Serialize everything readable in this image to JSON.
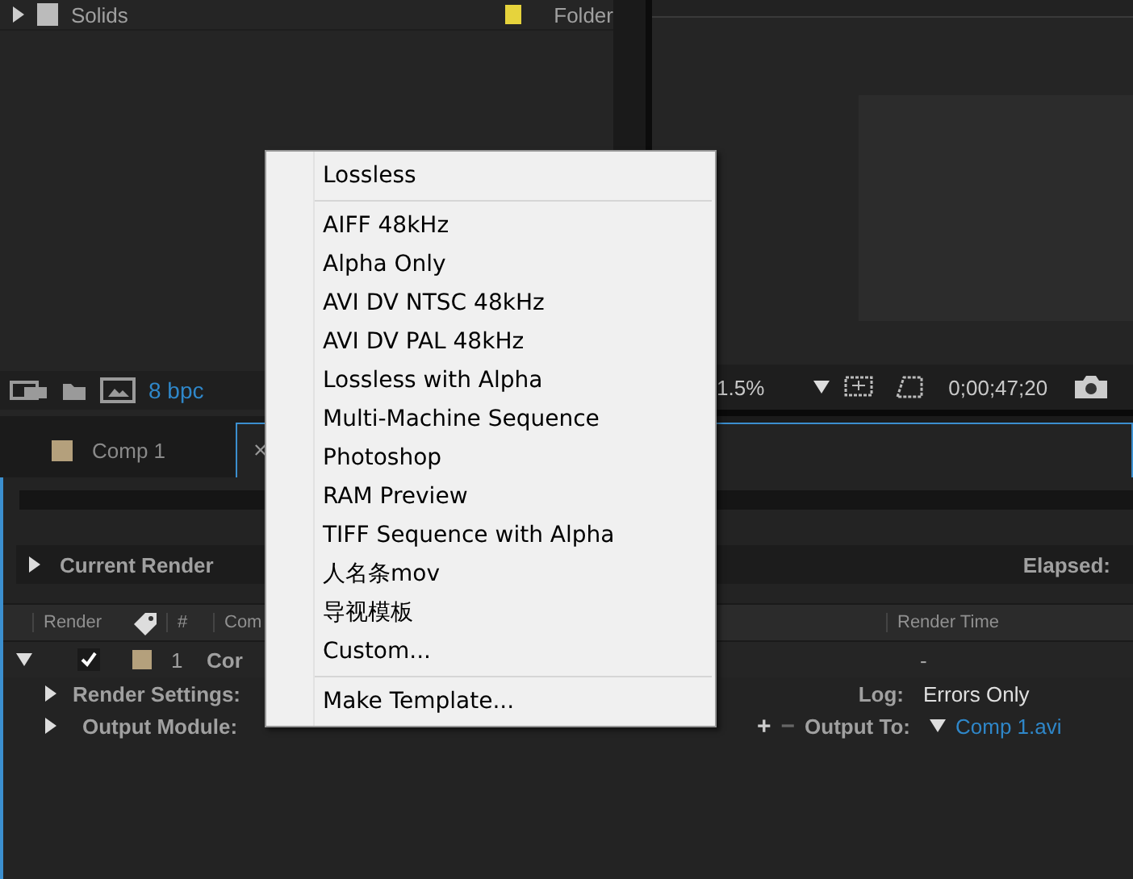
{
  "project_panel": {
    "rows": [
      {
        "name": "Solids",
        "type": "Folder",
        "color": "#e6d33c"
      }
    ],
    "bit_depth": "8 bpc"
  },
  "viewer": {
    "zoom": "1.5%",
    "timecode": "0;00;47;20"
  },
  "tabs": [
    {
      "label": "Comp 1",
      "color": "#b4a07c",
      "selected": false
    },
    {
      "close": "×",
      "selected": true
    }
  ],
  "render_queue": {
    "progress": {
      "level": 0
    },
    "current_render": "Current Render",
    "elapsed": "Elapsed:",
    "columns": [
      "Render",
      "#",
      "Com",
      "Render Time"
    ],
    "items": [
      {
        "checked": true,
        "expanded": true,
        "color": "#b4a07c",
        "number": "1",
        "name": "Cor",
        "render_time": "-",
        "render_settings_label": "Render Settings:",
        "log_label": "Log:",
        "log_value": "Errors Only",
        "output_module_label": "Output Module:",
        "add": "+",
        "remove": "−",
        "output_to_label": "Output To:",
        "output_file": "Comp 1.avi"
      }
    ]
  },
  "menu": {
    "items": [
      {
        "kind": "item",
        "label": "Lossless"
      },
      {
        "kind": "separator"
      },
      {
        "kind": "item",
        "label": "AIFF 48kHz"
      },
      {
        "kind": "item",
        "label": "Alpha Only"
      },
      {
        "kind": "item",
        "label": "AVI DV NTSC 48kHz"
      },
      {
        "kind": "item",
        "label": "AVI DV PAL 48kHz"
      },
      {
        "kind": "item",
        "label": "Lossless with Alpha"
      },
      {
        "kind": "item",
        "label": "Multi-Machine Sequence"
      },
      {
        "kind": "item",
        "label": "Photoshop"
      },
      {
        "kind": "item",
        "label": "RAM Preview"
      },
      {
        "kind": "item",
        "label": "TIFF Sequence with Alpha"
      },
      {
        "kind": "item",
        "label": "人名条mov"
      },
      {
        "kind": "item",
        "label": "导视模板"
      },
      {
        "kind": "item",
        "label": "Custom..."
      },
      {
        "kind": "separator"
      },
      {
        "kind": "item",
        "label": "Make Template..."
      }
    ]
  }
}
